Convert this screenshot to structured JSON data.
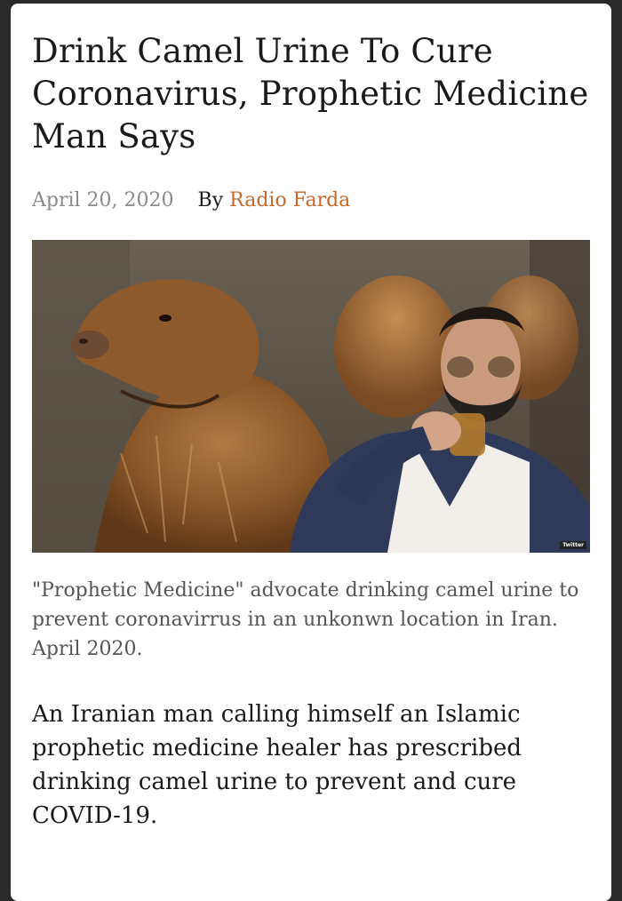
{
  "article": {
    "title": "Drink Camel Urine To Cure Coronavirus, Prophetic Medicine Man Says",
    "date": "April 20, 2020",
    "by_label": "By",
    "author": "Radio Farda",
    "image": {
      "description": "camel and man drinking from a glass",
      "watermark": "Twitter"
    },
    "caption": "\"Prophetic Medicine\" advocate drinking camel urine to prevent coronavirrus in an unkonwn location in Iran. April 2020.",
    "body": "An Iranian man calling himself an Islamic prophetic medicine healer has prescribed drinking camel urine to prevent and cure COVID-19."
  },
  "colors": {
    "author_link": "#c4692a",
    "date": "#8a8a8a",
    "background": "#2a2a2a"
  }
}
